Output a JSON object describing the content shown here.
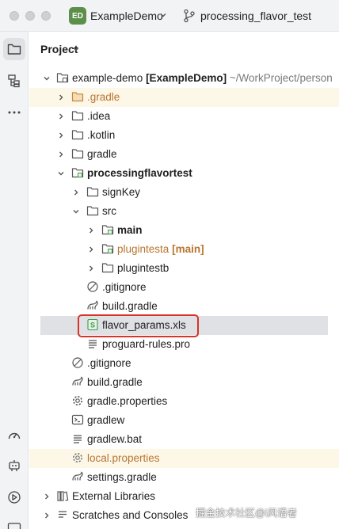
{
  "titlebar": {
    "badge": "ED",
    "project_name": "ExampleDemo",
    "branch": "processing_flavor_test"
  },
  "panel": {
    "title": "Project"
  },
  "tree": {
    "root_name": "example-demo",
    "root_tag": "[ExampleDemo]",
    "root_path": "~/WorkProject/person",
    "gradle_hidden": ".gradle",
    "idea": ".idea",
    "kotlin": ".kotlin",
    "gradle": "gradle",
    "module": "processingflavortest",
    "signkey": "signKey",
    "src": "src",
    "main": "main",
    "plugintesta": "plugintesta",
    "plugintesta_tag": "[main]",
    "plugintestb": "plugintestb",
    "module_gitignore": ".gitignore",
    "module_build_gradle": "build.gradle",
    "flavor_params": "flavor_params.xls",
    "proguard": "proguard-rules.pro",
    "gitignore": ".gitignore",
    "build_gradle": "build.gradle",
    "gradle_properties": "gradle.properties",
    "gradlew": "gradlew",
    "gradlew_bat": "gradlew.bat",
    "local_properties": "local.properties",
    "settings_gradle": "settings.gradle",
    "external_libraries": "External Libraries",
    "scratches": "Scratches and Consoles"
  },
  "watermark": "掘金技术社区@i风语者",
  "colors": {
    "highlight_box": "#d6332a",
    "excluded_bg": "#fdf7e8",
    "excluded_text": "#b8752f",
    "selection_bg": "#dfe1e5"
  }
}
